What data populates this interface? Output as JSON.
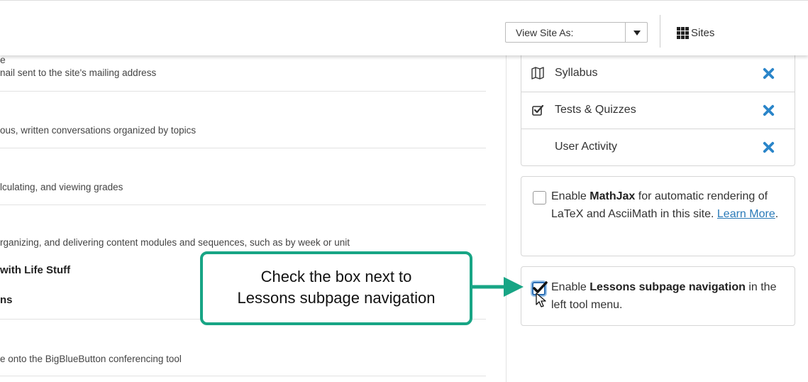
{
  "topbar": {
    "view_as": {
      "label": "View Site As:"
    },
    "sites_label": "Sites"
  },
  "left_list": {
    "rows": [
      {
        "title": "e",
        "description": "nail sent to the site's mailing address"
      },
      {
        "description": "ous, written conversations organized by topics"
      },
      {
        "description": "lculating, and viewing grades"
      },
      {
        "description": "rganizing, and delivering content modules and sequences, such as by week or unit"
      },
      {
        "subpage_1": "with Life Stuff",
        "subpage_2": "ns"
      },
      {
        "description": "e onto the BigBlueButton conferencing tool"
      }
    ]
  },
  "tools": [
    {
      "name": "Syllabus",
      "icon": "map-icon"
    },
    {
      "name": "Tests & Quizzes",
      "icon": "checkbox-icon"
    },
    {
      "name": "User Activity",
      "icon": ""
    }
  ],
  "options": {
    "mathjax": {
      "checked": false,
      "prefix": "Enable ",
      "bold": "MathJax",
      "suffix": " for automatic rendering of LaTeX and AsciiMath in this site. ",
      "link": "Learn More",
      "end": "."
    },
    "lessons": {
      "checked": true,
      "prefix": "Enable ",
      "bold": "Lessons subpage navigation",
      "suffix": " in the left tool menu."
    }
  },
  "callout": {
    "line1": "Check the box next to",
    "line2": "Lessons subpage navigation"
  },
  "colors": {
    "accent": "#18a585",
    "remove": "#2a85c9",
    "link": "#2a7ab8"
  }
}
